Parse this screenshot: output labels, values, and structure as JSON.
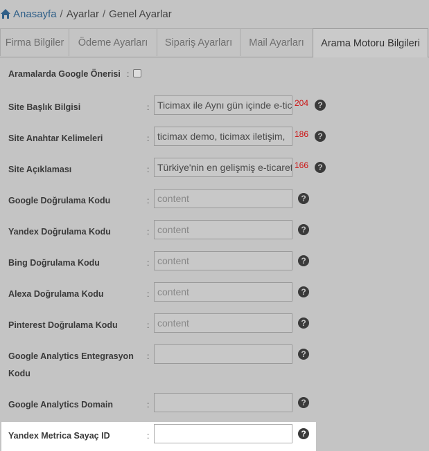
{
  "breadcrumb": {
    "home": "Anasayfa",
    "sep1": "/",
    "item1": "Ayarlar",
    "sep2": "/",
    "item2": "Genel Ayarlar"
  },
  "tabs": [
    {
      "label": "Firma Bilgiler"
    },
    {
      "label": "Ödeme Ayarları"
    },
    {
      "label": "Sipariş Ayarları"
    },
    {
      "label": "Mail Ayarları"
    },
    {
      "label": "Arama Motoru Bilgileri"
    }
  ],
  "form": {
    "google_suggest": {
      "label": "Aramalarda Google Önerisi",
      "colon": ":"
    },
    "rows": [
      {
        "label": "Site Başlık Bilgisi",
        "colon": ":",
        "value": "Ticimax ile Aynı gün içinde e-ticaret",
        "count": "204"
      },
      {
        "label": "Site Anahtar Kelimeleri",
        "colon": ":",
        "value": "ticimax demo, ticimax iletişim,",
        "count": "186"
      },
      {
        "label": "Site Açıklaması",
        "colon": ":",
        "value": "Türkiye'nin en gelişmiş e-ticaret",
        "count": "166"
      },
      {
        "label": "Google Doğrulama Kodu",
        "colon": ":",
        "placeholder": "content"
      },
      {
        "label": "Yandex Doğrulama Kodu",
        "colon": ":",
        "placeholder": "content"
      },
      {
        "label": "Bing Doğrulama Kodu",
        "colon": ":",
        "placeholder": "content"
      },
      {
        "label": "Alexa Doğrulama Kodu",
        "colon": ":",
        "placeholder": "content"
      },
      {
        "label": "Pinterest Doğrulama Kodu",
        "colon": ":",
        "placeholder": "content"
      },
      {
        "label": "Google Analytics Entegrasyon Kodu",
        "colon": ":",
        "value": ""
      },
      {
        "label": "Google Analytics Domain",
        "colon": ":",
        "value": ""
      },
      {
        "label": "Yandex Metrica Sayaç ID",
        "colon": ":",
        "value": ""
      }
    ],
    "help_glyph": "?"
  }
}
